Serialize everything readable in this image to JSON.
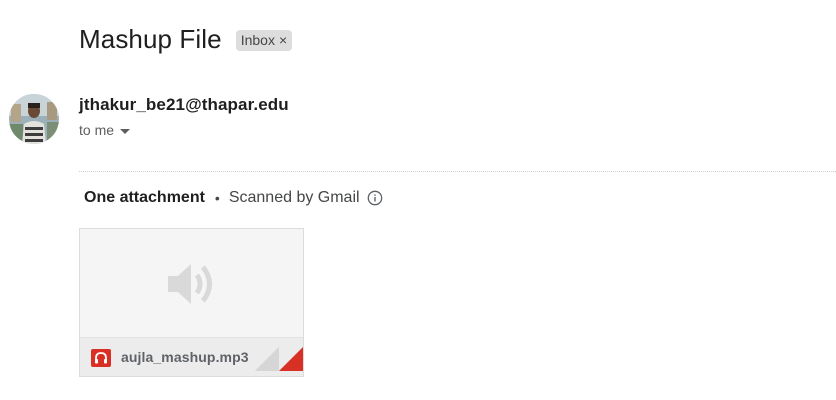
{
  "email": {
    "subject": "Mashup File",
    "label": {
      "text": "Inbox",
      "remove_glyph": "×"
    }
  },
  "sender": {
    "address": "jthakur_be21@thapar.edu",
    "recipient_text": "to me"
  },
  "attachments": {
    "count_text": "One attachment",
    "separator": "•",
    "scan_text": "Scanned by Gmail",
    "items": [
      {
        "filename": "aujla_mashup.mp3",
        "type_icon": "audio-file-icon",
        "preview_icon": "speaker-icon",
        "type_color": "#d93025"
      }
    ]
  }
}
